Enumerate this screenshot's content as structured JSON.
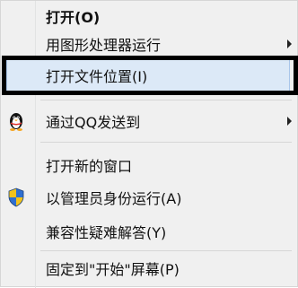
{
  "menu": {
    "items": [
      {
        "label": "打开(O)",
        "bold": true
      },
      {
        "label": "用图形处理器运行",
        "submenu": true
      },
      {
        "label": "打开文件位置(I)",
        "highlighted": true
      },
      {
        "label": "通过QQ发送到",
        "submenu": true,
        "icon": "qq-penguin-icon"
      },
      {
        "label": "打开新的窗口"
      },
      {
        "label": "以管理员身份运行(A)",
        "icon": "uac-shield-icon"
      },
      {
        "label": "兼容性疑难解答(Y)"
      },
      {
        "label": "固定到\"开始\"屏幕(P)"
      }
    ]
  },
  "colors": {
    "menu_bg": "#f0f0f0",
    "highlight_bg": "#dce9f7",
    "highlight_border": "#a9c6ea",
    "annotation_border": "#000000"
  }
}
